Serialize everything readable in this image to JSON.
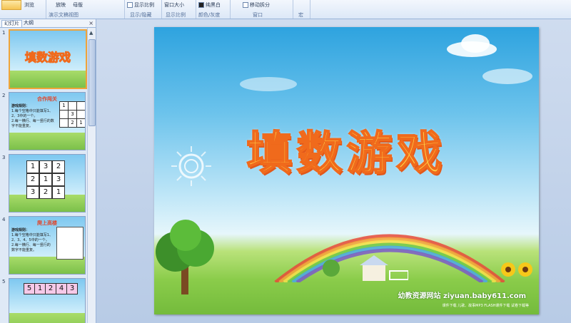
{
  "ribbon": {
    "groups": [
      {
        "items": [
          "浏览"
        ],
        "caption": "演示文稿视图"
      },
      {
        "items": [
          "放映",
          "母版"
        ],
        "caption": ""
      },
      {
        "items": [
          "显示比例"
        ],
        "caption": "显示/隐藏"
      },
      {
        "items": [
          "窗口大小"
        ],
        "caption": "显示比例"
      },
      {
        "items": [
          "纯黑白"
        ],
        "caption": "颜色/灰度"
      },
      {
        "items": [
          "移动拆分"
        ],
        "caption": "窗口"
      },
      {
        "items": [],
        "caption": "宏"
      }
    ]
  },
  "pane": {
    "tabs": [
      "幻灯片",
      "大纲"
    ],
    "close": "×",
    "slides": [
      {
        "num": "1",
        "title": "填数游戏"
      },
      {
        "num": "2",
        "title": "合作闯关",
        "rules_head": "游戏规则：",
        "rule1": "1.每个空格中只能填写1、2、3中的一个。",
        "rule2": "2.每一横行、每一竖行的数字不能重复。",
        "grid": [
          "1",
          "",
          "",
          "3",
          "",
          "",
          "2",
          "1"
        ]
      },
      {
        "num": "3",
        "grid": [
          "1",
          "3",
          "2",
          "2",
          "1",
          "3",
          "3",
          "2",
          "1"
        ]
      },
      {
        "num": "4",
        "title": "爬上高楼",
        "rules_head": "游戏规则：",
        "rule1": "1.每个空格中只能填写1、2、3、4、5中的一个。",
        "rule2": "2.每一横行、每一竖行的数字不能重复。"
      },
      {
        "num": "5",
        "grid": [
          "5",
          "1",
          "2",
          "4",
          "3"
        ]
      }
    ]
  },
  "slide": {
    "title": "填数游戏",
    "site": "幼教资源网站  ziyuan.baby611.com",
    "sub": "课件下载   儿歌、故事MP3   FLASH课件下载   试卷下载等"
  }
}
